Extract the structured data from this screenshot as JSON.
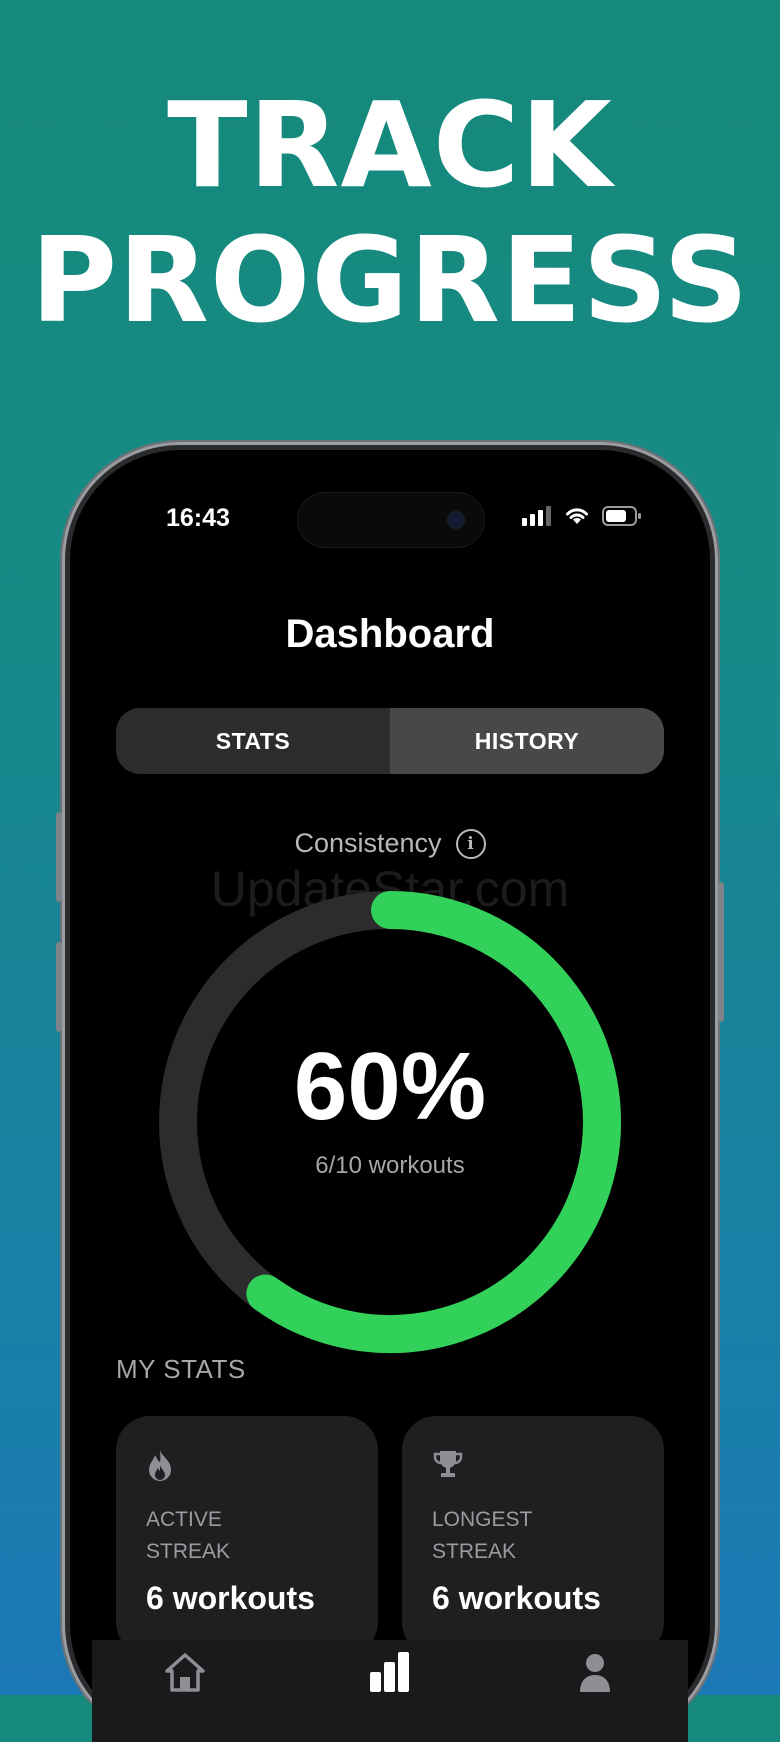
{
  "headline": {
    "line1": "TRACK",
    "line2": "PROGRESS"
  },
  "status_bar": {
    "time": "16:43"
  },
  "screen": {
    "title": "Dashboard",
    "tabs": [
      {
        "label": "STATS",
        "active": false
      },
      {
        "label": "HISTORY",
        "active": true
      }
    ],
    "consistency": {
      "label": "Consistency",
      "percent_text": "60%",
      "progress": 0.6,
      "workouts_text": "6/10 workouts"
    },
    "watermark": "UpdateStar.com",
    "my_stats": {
      "heading": "MY STATS",
      "cards": [
        {
          "icon": "flame-icon",
          "label_line1": "ACTIVE",
          "label_line2": "STREAK",
          "value": "6 workouts"
        },
        {
          "icon": "trophy-icon",
          "label_line1": "LONGEST",
          "label_line2": "STREAK",
          "value": "6 workouts"
        }
      ]
    },
    "tab_bar": [
      "home-icon",
      "chart-bars-icon",
      "person-icon"
    ]
  },
  "colors": {
    "accent_green": "#32d15a",
    "ring_track": "#2c2c2e",
    "background_top": "#15897a",
    "background_bottom": "#1b78b6"
  }
}
